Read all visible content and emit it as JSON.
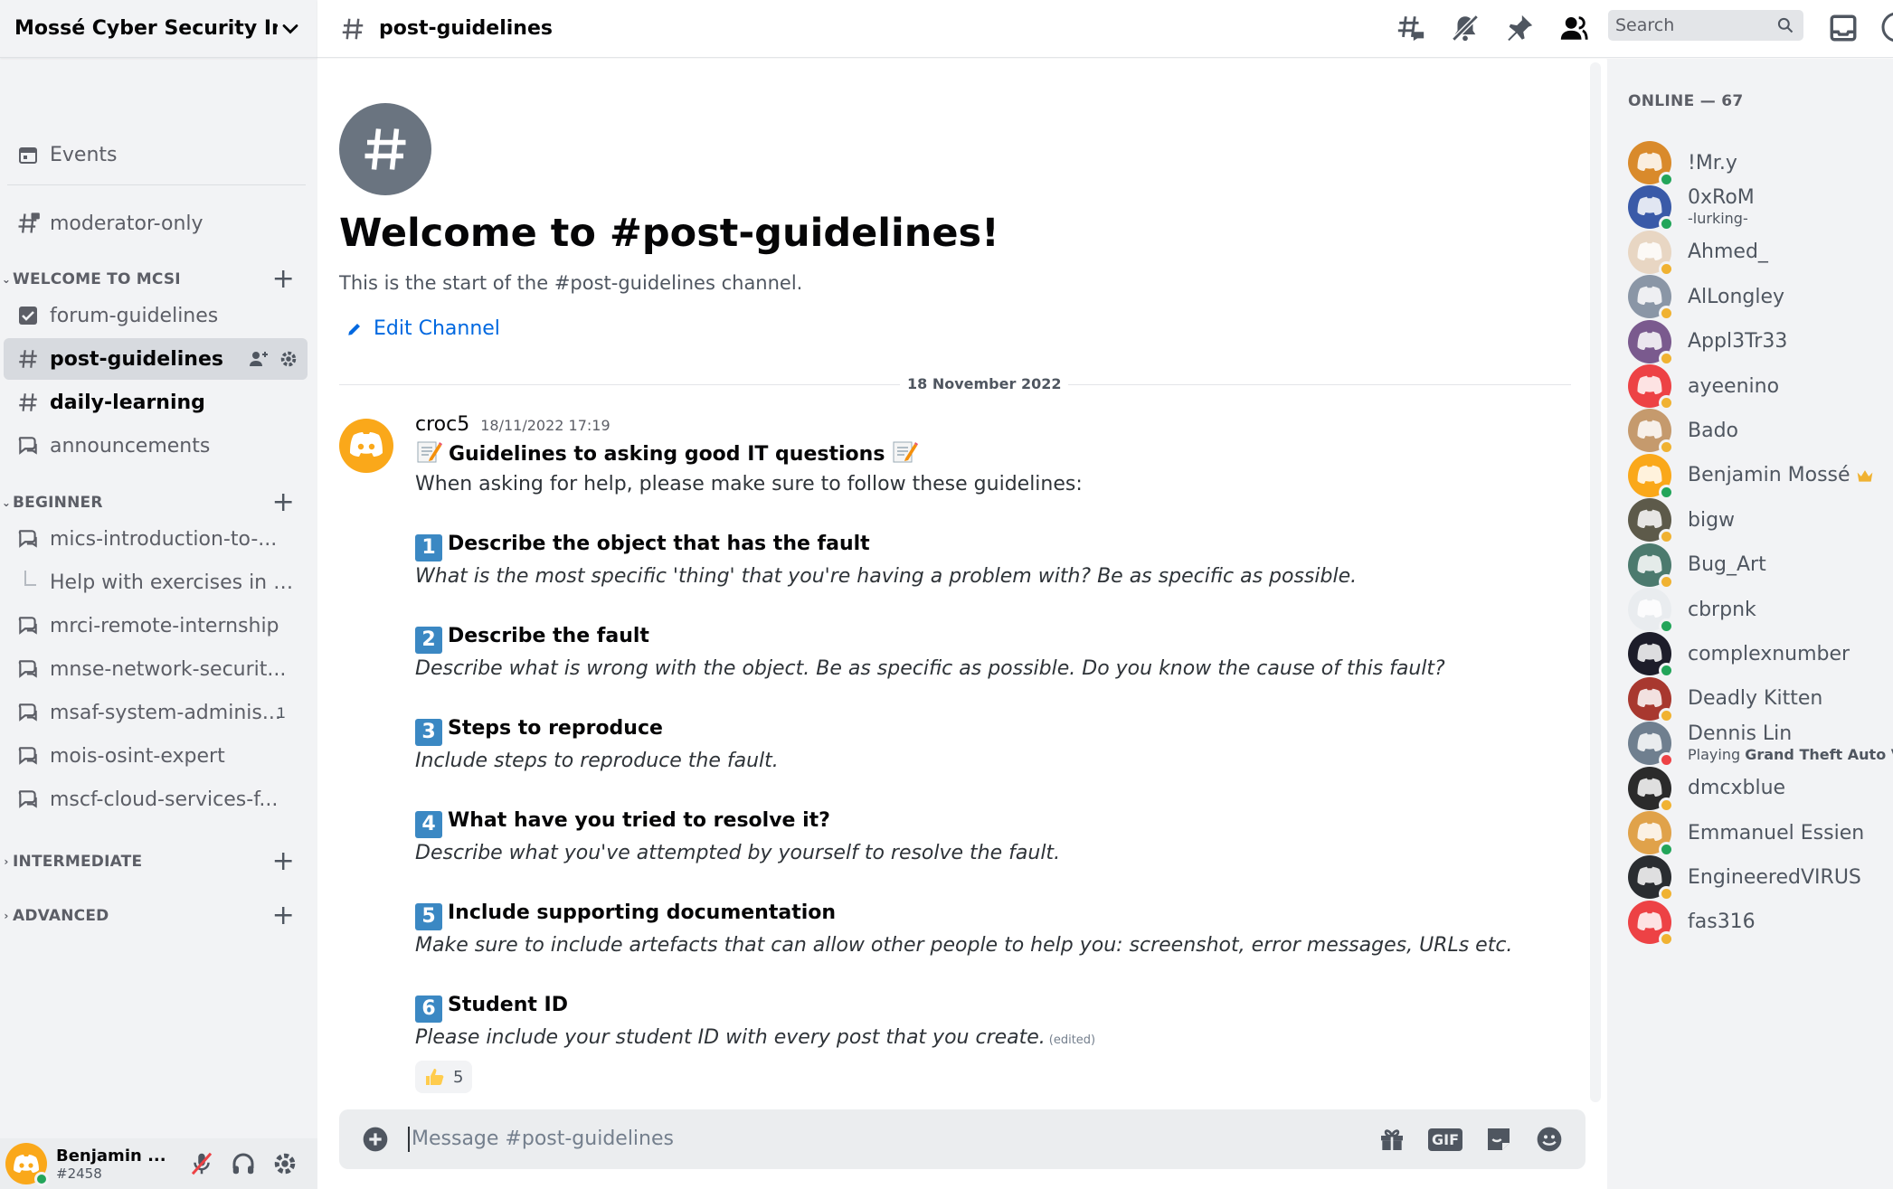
{
  "server": {
    "name": "Mossé Cyber Security In..."
  },
  "sidebar": {
    "events_label": "Events",
    "channels": {
      "moderator_only": "moderator-only",
      "forum_guidelines": "forum-guidelines",
      "post_guidelines": "post-guidelines",
      "daily_learning": "daily-learning",
      "announcements": "announcements",
      "mics": "mics-introduction-to-...",
      "help_thread": "Help with exercises in MI...",
      "mrci": "mrci-remote-internship",
      "mnse": "mnse-network-securit...",
      "msaf": "msaf-system-adminis...",
      "msaf_badge": "1",
      "mois": "mois-osint-expert",
      "mscf": "mscf-cloud-services-f..."
    },
    "categories": {
      "welcome": "WELCOME TO MCSI",
      "beginner": "BEGINNER",
      "intermediate": "INTERMEDIATE",
      "advanced": "ADVANCED"
    }
  },
  "user_panel": {
    "name": "Benjamin ...",
    "tag": "#2458",
    "status_color": "#23a55a"
  },
  "topbar": {
    "channel": "post-guidelines",
    "search_placeholder": "Search"
  },
  "chat": {
    "welcome_title": "Welcome to #post-guidelines!",
    "welcome_sub": "This is the start of the #post-guidelines channel.",
    "edit_channel": "Edit Channel",
    "date_divider": "18 November 2022",
    "message": {
      "author": "croc5",
      "timestamp": "18/11/2022 17:19",
      "heading": "Guidelines to asking good IT questions",
      "intro": "When asking for help, please make sure to follow these guidelines:",
      "items": [
        {
          "num": "1",
          "title": "Describe the object that has the fault",
          "desc": "What is the most specific 'thing' that you're having a problem with? Be as specific as possible."
        },
        {
          "num": "2",
          "title": "Describe the fault",
          "desc": "Describe what is wrong with the object. Be as specific as possible. Do you know the cause of this fault?"
        },
        {
          "num": "3",
          "title": "Steps to reproduce",
          "desc": "Include steps to reproduce the fault."
        },
        {
          "num": "4",
          "title": "What have you tried to resolve it?",
          "desc": "Describe what you've attempted by yourself to resolve the fault."
        },
        {
          "num": "5",
          "title": "Include supporting documentation",
          "desc": "Make sure to include artefacts that can allow other people to help you: screenshot, error messages, URLs etc."
        },
        {
          "num": "6",
          "title": "Student ID",
          "desc": "Please include your student ID with every post that you create."
        }
      ],
      "edited": "(edited)",
      "reaction_count": "5"
    },
    "composer_placeholder": "Message #post-guidelines",
    "gif_label": "GIF"
  },
  "members": {
    "online_title": "ONLINE — 67",
    "list": [
      {
        "name": "!Mr.y",
        "status": "#23a55a",
        "avatar": "#d98a2b"
      },
      {
        "name": "0xRoM",
        "activity": "-lurking-",
        "status": "#23a55a",
        "avatar": "#3a5aa8"
      },
      {
        "name": "Ahmed_",
        "status": "#f0b232",
        "avatar": "#e8d6c3"
      },
      {
        "name": "AlLongley",
        "status": "#f0b232",
        "avatar": "#8a96a6"
      },
      {
        "name": "Appl3Tr33",
        "status": "#f0b232",
        "avatar": "#7a5a8e"
      },
      {
        "name": "ayeenino",
        "status": "#f0b232",
        "avatar": "#ed4245"
      },
      {
        "name": "Bado",
        "status": "#f0b232",
        "avatar": "#c59a6d"
      },
      {
        "name": "Benjamin Mossé",
        "status": "#23a55a",
        "avatar": "#faa81a",
        "crown": true
      },
      {
        "name": "bigw",
        "status": "#f0b232",
        "avatar": "#5d5a4a"
      },
      {
        "name": "Bug_Art",
        "status": "#f0b232",
        "avatar": "#4c7a6e"
      },
      {
        "name": "cbrpnk",
        "status": "#23a55a",
        "avatar": "#e9ecef"
      },
      {
        "name": "complexnumber",
        "status": "#23a55a",
        "avatar": "#1d1d2a"
      },
      {
        "name": "Deadly Kitten",
        "status": "#f0b232",
        "avatar": "#a8382f"
      },
      {
        "name": "Dennis Lin",
        "activity_prefix": "Playing",
        "activity_game": "Grand Theft Auto V",
        "status": "#ed4245",
        "avatar": "#6f7f8f"
      },
      {
        "name": "dmcxblue",
        "status": "#f0b232",
        "avatar": "#2b2b2b"
      },
      {
        "name": "Emmanuel Essien",
        "status": "#23a55a",
        "avatar": "#e0a24a"
      },
      {
        "name": "EngineeredVIRUS",
        "status": "#f0b232",
        "avatar": "#2a2d31"
      },
      {
        "name": "fas316",
        "status": "#f0b232",
        "avatar": "#ed4245"
      }
    ]
  }
}
